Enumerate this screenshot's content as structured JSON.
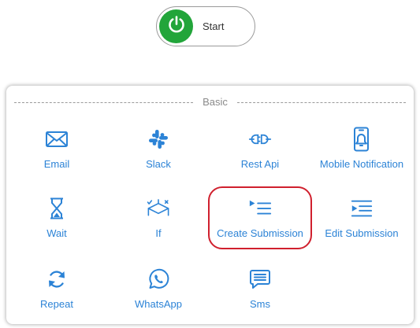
{
  "start": {
    "label": "Start",
    "icon": "power-icon",
    "color": "#22a53a"
  },
  "panel": {
    "section_title": "Basic",
    "accent_color": "#2c83d6",
    "highlight_color": "#d0202e",
    "items": [
      {
        "label": "Email",
        "icon": "envelope-icon"
      },
      {
        "label": "Slack",
        "icon": "slack-icon"
      },
      {
        "label": "Rest Api",
        "icon": "plug-icon"
      },
      {
        "label": "Mobile Notification",
        "icon": "mobile-bell-icon"
      },
      {
        "label": "Wait",
        "icon": "hourglass-icon"
      },
      {
        "label": "If",
        "icon": "branch-icon"
      },
      {
        "label": "Create Submission",
        "icon": "list-indent-icon",
        "highlighted": true
      },
      {
        "label": "Edit Submission",
        "icon": "list-indent-icon"
      },
      {
        "label": "Repeat",
        "icon": "refresh-icon"
      },
      {
        "label": "WhatsApp",
        "icon": "whatsapp-icon"
      },
      {
        "label": "Sms",
        "icon": "chat-icon"
      }
    ]
  }
}
